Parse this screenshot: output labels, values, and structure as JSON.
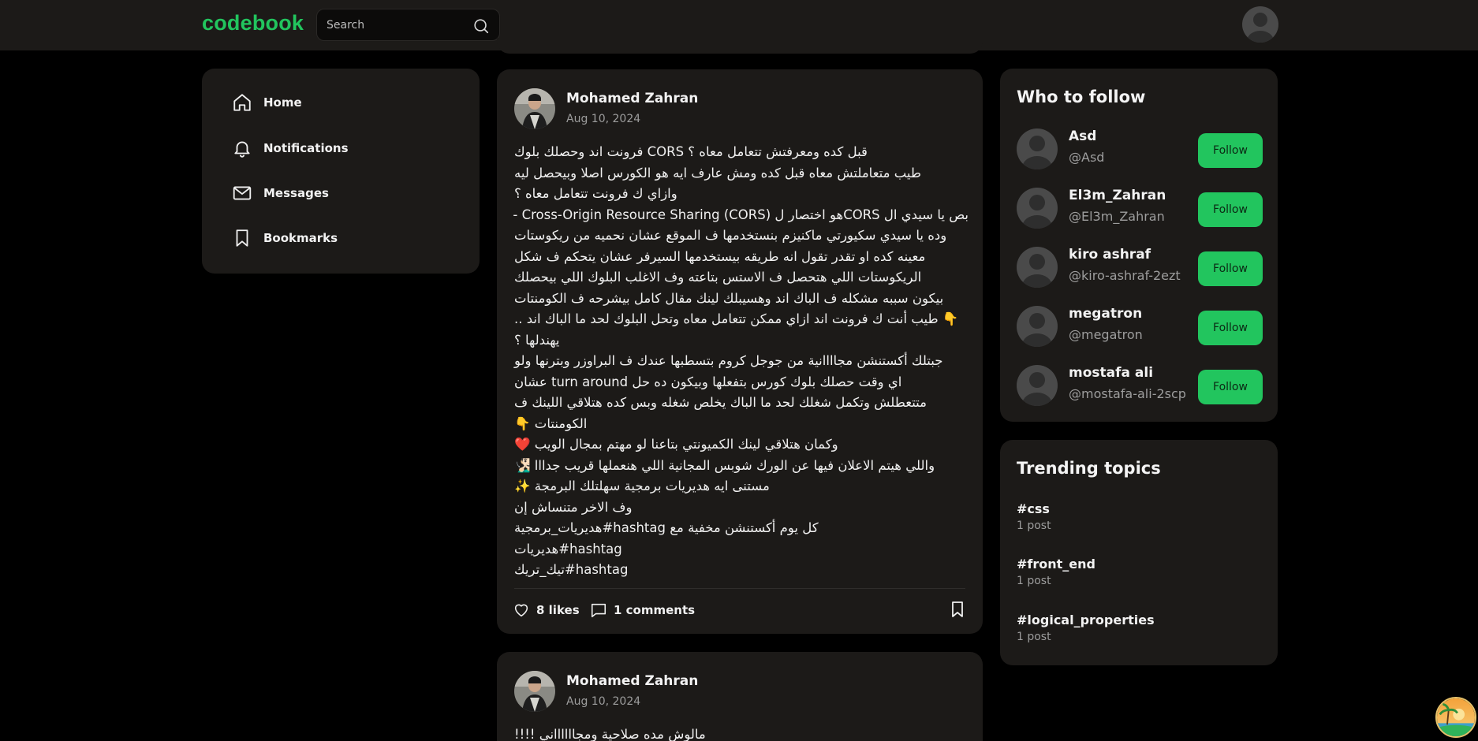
{
  "header": {
    "logo": "codebook",
    "search_placeholder": "Search"
  },
  "sidebar": {
    "items": [
      {
        "label": "Home",
        "icon": "home-icon"
      },
      {
        "label": "Notifications",
        "icon": "bell-icon"
      },
      {
        "label": "Messages",
        "icon": "mail-icon"
      },
      {
        "label": "Bookmarks",
        "icon": "bookmark-icon"
      }
    ]
  },
  "posts": [
    {
      "author": "Mohamed Zahran",
      "date": "Aug 10, 2024",
      "lines": [
        "قبل كده ومعرفتش تتعامل معاه ؟ CORS فرونت اند وحصلك بلوك",
        "طيب متعاملتش معاه قبل كده ومش عارف ايه هو الكورس اصلا وبيحصل ليه",
        "وازاي ك فرونت تتعامل معاه ؟",
        "بص يا سيدي ال CORSهو اختصار ل Cross-Origin Resource Sharing (CORS) -",
        "وده يا سيدي سكيورتي ماكنيزم بنستخدمها ف الموقع عشان نحميه من ريكوستات",
        "معينه كده او تقدر تقول انه طريقه بيستخدمها السيرفر عشان يتحكم ف شكل",
        "الريكوستات اللي هتحصل ف الاستس بتاعته وف الاغلب البلوك اللي بيحصلك",
        "بيكون سببه مشكله ف الباك اند وهسيبلك لينك مقال كامل بيشرحه ف الكومنتات",
        "👇 طيب أنت ك فرونت اند ازاي ممكن تتعامل معاه وتحل البلوك لحد ما الباك اند ..",
        "يهندلها ؟",
        "جبتلك أكستنشن مجاااانية من جوجل كروم بتسطبها عندك ف البراوزر وبترنها ولو",
        "اي وقت حصلك بلوك كورس بتفعلها وبيكون ده حل turn around عشان",
        "متتعطلش وتكمل شغلك لحد ما الباك يخلص شغله وبس كده هتلاقي اللينك ف",
        "الكومنتات 👇",
        "وكمان هتلاقي لينك الكميونتي بتاعنا لو مهتم بمجال الويب ❤️",
        "واللي هيتم الاعلان فيها عن الورك شوبس المجانية اللي هنعملها قريب جدااا 🧏🏻‍♂️",
        "مستنى ايه هديريات برمجية سهلتلك البرمجة ✨",
        "وف الاخر متنساش إن",
        "كل يوم أكستنشن مخفية مع hashtag#هديريات_برمجية",
        "hashtag#هديريات",
        "hashtag#تيك_تريك"
      ],
      "likes": "8 likes",
      "comments": "1 comments"
    },
    {
      "author": "Mohamed Zahran",
      "date": "Aug 10, 2024",
      "lines": [
        "مالوش مده صلاحية ومجااااااني !!!!"
      ]
    }
  ],
  "who_to_follow": {
    "title": "Who to follow",
    "users": [
      {
        "name": "Asd",
        "handle": "@Asd",
        "button": "Follow"
      },
      {
        "name": "El3m_Zahran",
        "handle": "@El3m_Zahran",
        "button": "Follow"
      },
      {
        "name": "kiro ashraf",
        "handle": "@kiro-ashraf-2ezt",
        "button": "Follow"
      },
      {
        "name": "megatron",
        "handle": "@megatron",
        "button": "Follow"
      },
      {
        "name": "mostafa ali",
        "handle": "@mostafa-ali-2scp",
        "button": "Follow"
      }
    ]
  },
  "trending": {
    "title": "Trending topics",
    "topics": [
      {
        "tag": "#css",
        "count": "1 post"
      },
      {
        "tag": "#front_end",
        "count": "1 post"
      },
      {
        "tag": "#logical_properties",
        "count": "1 post"
      }
    ]
  },
  "colors": {
    "accent": "#22c55e",
    "card": "#1c1a18",
    "background": "#000000"
  }
}
